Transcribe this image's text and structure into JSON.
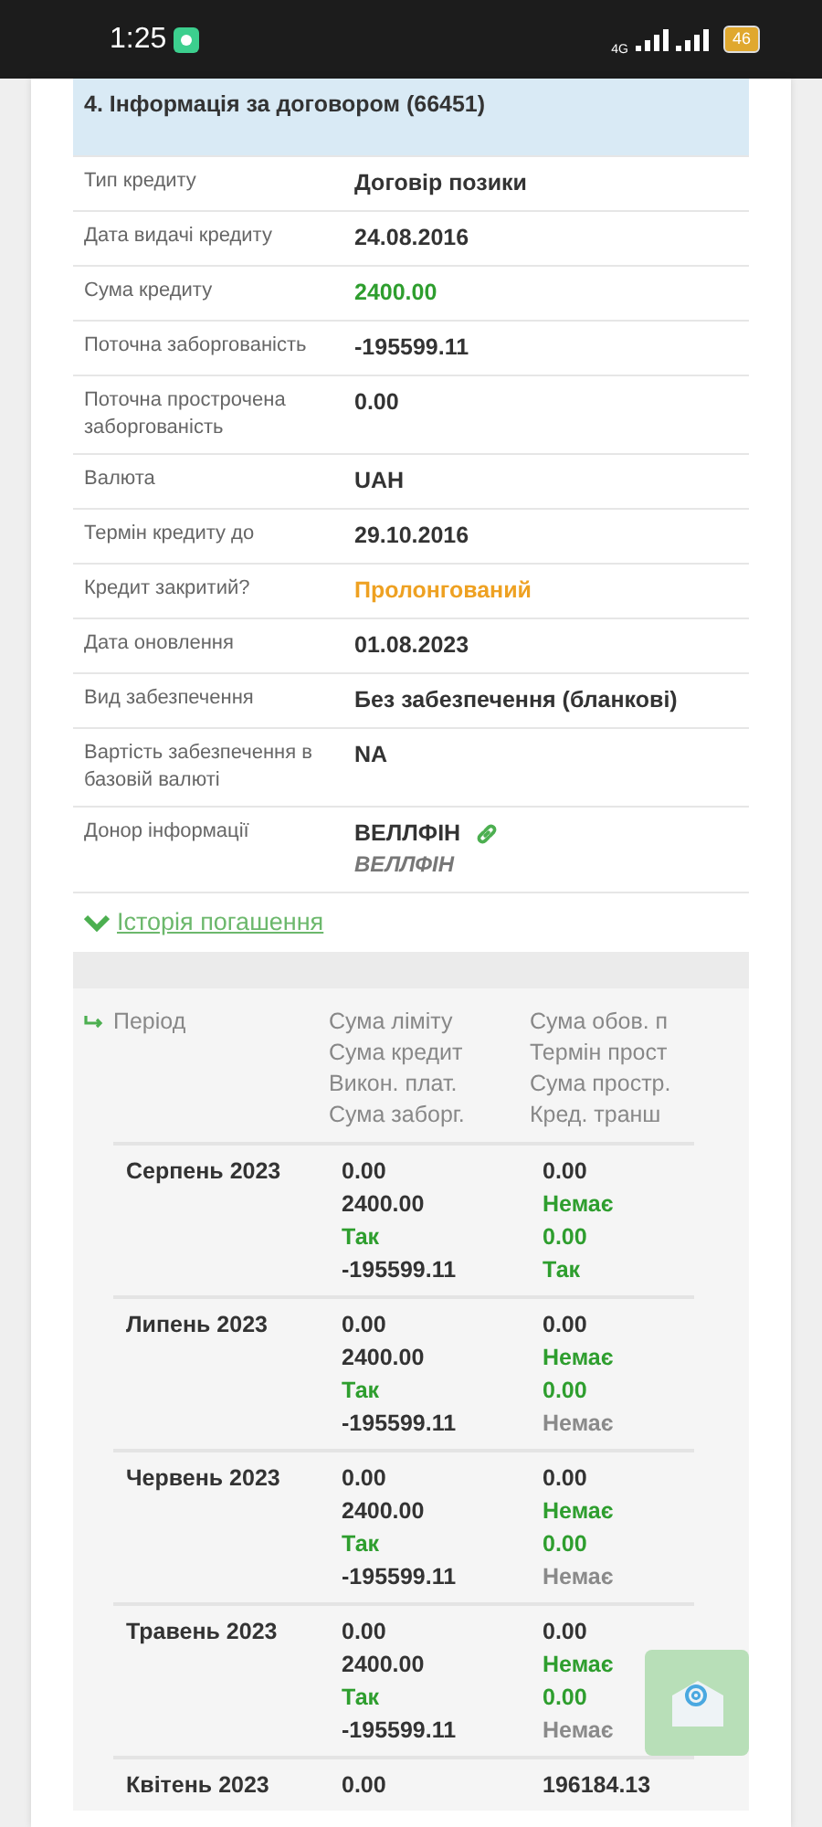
{
  "status_bar": {
    "time": "1:25",
    "network": "4G",
    "battery": "46"
  },
  "section": {
    "title": "4. Інформація за договором (66451)"
  },
  "info_rows": [
    {
      "label": "Тип кредиту",
      "value": "Договір позики",
      "color": "#333333"
    },
    {
      "label": "Дата видачі кредиту",
      "value": "24.08.2016",
      "color": "#333333"
    },
    {
      "label": "Сума кредиту",
      "value": "2400.00",
      "color": "#2e9e2e"
    },
    {
      "label": "Поточна заборгованість",
      "value": "-195599.11",
      "color": "#333333"
    },
    {
      "label": "Поточна прострочена заборгованість",
      "value": "0.00",
      "color": "#333333"
    },
    {
      "label": "Валюта",
      "value": "UAH",
      "color": "#333333"
    },
    {
      "label": "Термін кредиту до",
      "value": "29.10.2016",
      "color": "#333333"
    },
    {
      "label": "Кредит закритий?",
      "value": "Пролонгований",
      "color": "#eea122"
    },
    {
      "label": "Дата оновлення",
      "value": "01.08.2023",
      "color": "#333333"
    },
    {
      "label": "Вид забезпечення",
      "value": "Без забезпечення (бланкові)",
      "color": "#333333"
    },
    {
      "label": "Вартість забезпечення в базовій валюті",
      "value": "NA",
      "color": "#333333"
    },
    {
      "label": "Донор інформації",
      "value": "ВЕЛЛФІН",
      "color": "#333333",
      "subvalue": "ВЕЛЛФІН",
      "link": true
    }
  ],
  "history": {
    "toggle": "Історія погашення",
    "expanded": true,
    "columns": [
      {
        "lines": [
          "Період"
        ]
      },
      {
        "lines": [
          "Сума ліміту",
          "Сума кредит",
          "Викон. плат.",
          "Сума заборг."
        ]
      },
      {
        "lines": [
          "Сума обов. п",
          "Термін прост",
          "Сума простр.",
          "Кред. транш"
        ]
      }
    ],
    "rows": [
      {
        "period": "Серпень 2023",
        "col2": [
          {
            "text": "0.00",
            "color": "#333333"
          },
          {
            "text": "2400.00",
            "color": "#333333"
          },
          {
            "text": "Так",
            "color": "#2e9e2e"
          },
          {
            "text": "-195599.11",
            "color": "#333333"
          }
        ],
        "col3": [
          {
            "text": "0.00",
            "color": "#333333"
          },
          {
            "text": "Немає",
            "color": "#2e9e2e"
          },
          {
            "text": "0.00",
            "color": "#2e9e2e"
          },
          {
            "text": "Так",
            "color": "#2e9e2e"
          }
        ]
      },
      {
        "period": "Липень 2023",
        "col2": [
          {
            "text": "0.00",
            "color": "#333333"
          },
          {
            "text": "2400.00",
            "color": "#333333"
          },
          {
            "text": "Так",
            "color": "#2e9e2e"
          },
          {
            "text": "-195599.11",
            "color": "#333333"
          }
        ],
        "col3": [
          {
            "text": "0.00",
            "color": "#333333"
          },
          {
            "text": "Немає",
            "color": "#2e9e2e"
          },
          {
            "text": "0.00",
            "color": "#2e9e2e"
          },
          {
            "text": "Немає",
            "color": "#8a8a8a"
          }
        ]
      },
      {
        "period": "Червень 2023",
        "col2": [
          {
            "text": "0.00",
            "color": "#333333"
          },
          {
            "text": "2400.00",
            "color": "#333333"
          },
          {
            "text": "Так",
            "color": "#2e9e2e"
          },
          {
            "text": "-195599.11",
            "color": "#333333"
          }
        ],
        "col3": [
          {
            "text": "0.00",
            "color": "#333333"
          },
          {
            "text": "Немає",
            "color": "#2e9e2e"
          },
          {
            "text": "0.00",
            "color": "#2e9e2e"
          },
          {
            "text": "Немає",
            "color": "#8a8a8a"
          }
        ]
      },
      {
        "period": "Травень 2023",
        "col2": [
          {
            "text": "0.00",
            "color": "#333333"
          },
          {
            "text": "2400.00",
            "color": "#333333"
          },
          {
            "text": "Так",
            "color": "#2e9e2e"
          },
          {
            "text": "-195599.11",
            "color": "#333333"
          }
        ],
        "col3": [
          {
            "text": "0.00",
            "color": "#333333"
          },
          {
            "text": "Немає",
            "color": "#2e9e2e"
          },
          {
            "text": "0.00",
            "color": "#2e9e2e"
          },
          {
            "text": "Немає",
            "color": "#8a8a8a"
          }
        ]
      },
      {
        "period": "Квітень 2023",
        "col2": [
          {
            "text": "0.00",
            "color": "#333333"
          }
        ],
        "col3": [
          {
            "text": "196184.13",
            "color": "#333333"
          }
        ]
      }
    ]
  }
}
